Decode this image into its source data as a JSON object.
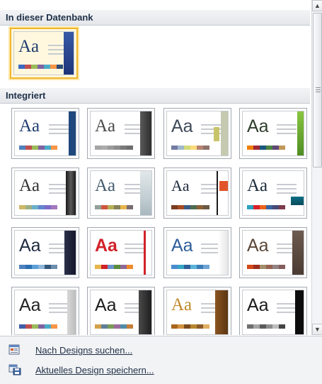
{
  "sections": {
    "database": {
      "title": "In dieser Datenbank"
    },
    "builtin": {
      "title": "Integriert"
    }
  },
  "thumb_text": "Aa",
  "commands": {
    "search_label": "Nach Designs suchen...",
    "search_icon": "search-designs-icon",
    "save_label": "Aktuelles Design speichern...",
    "save_icon": "save-design-icon"
  },
  "scrollbar": {
    "up": "▲",
    "down": "▼"
  },
  "colors": {
    "selected": "#f2b62b",
    "header": "#20324a"
  }
}
